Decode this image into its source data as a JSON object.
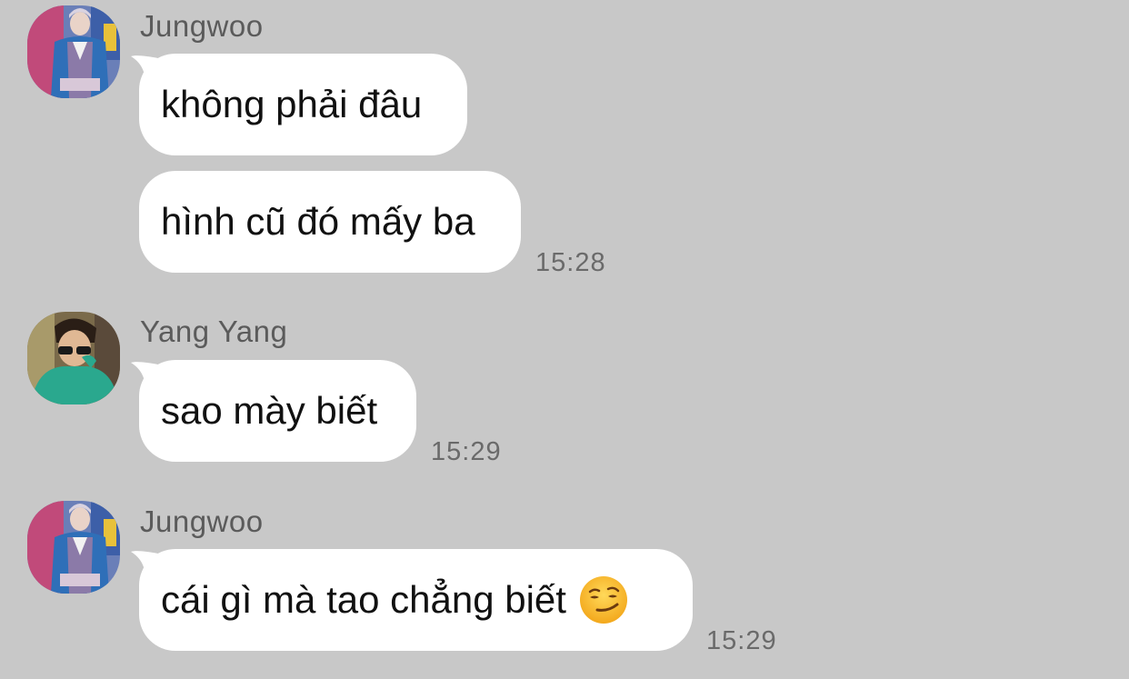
{
  "messages": [
    {
      "sender": "Jungwoo",
      "avatar_icon": "jungwoo-avatar",
      "bubbles": [
        {
          "text": "không phải đâu"
        },
        {
          "text": "hình cũ đó mấy ba",
          "time": "15:28"
        }
      ]
    },
    {
      "sender": "Yang Yang",
      "avatar_icon": "yangyang-avatar",
      "bubbles": [
        {
          "text": "sao mày biết",
          "time": "15:29"
        }
      ]
    },
    {
      "sender": "Jungwoo",
      "avatar_icon": "jungwoo-avatar",
      "bubbles": [
        {
          "text": "cái gì mà tao chẳng biết",
          "emoji": "smirking-face-icon",
          "time": "15:29"
        }
      ]
    }
  ],
  "colors": {
    "background": "#c8c8c8",
    "bubble": "#ffffff",
    "sender_text": "#5b5b5b",
    "time_text": "#6a6a6a"
  }
}
